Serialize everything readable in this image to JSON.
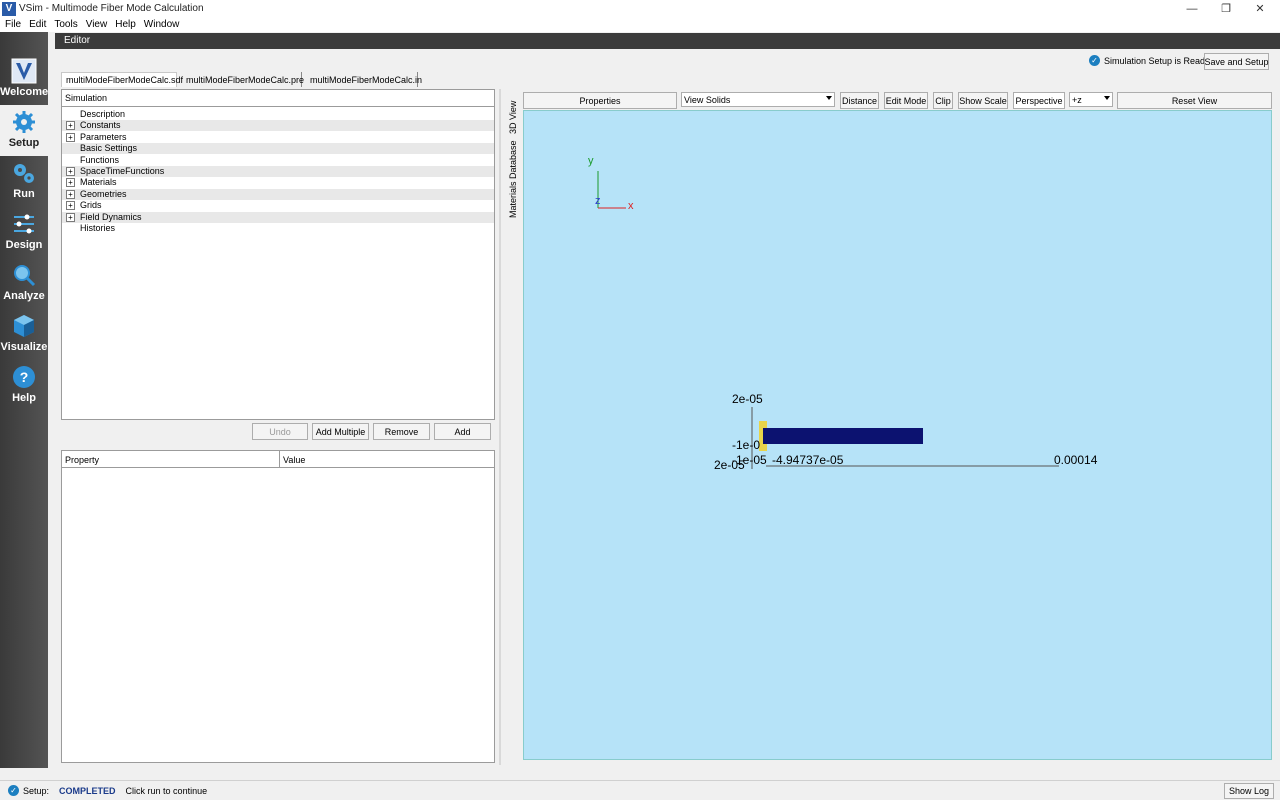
{
  "window": {
    "title": "VSim - Multimode Fiber Mode Calculation",
    "app_icon": "V",
    "controls": {
      "minimize": "—",
      "maximize": "❐",
      "close": "✕"
    }
  },
  "menu": [
    "File",
    "Edit",
    "Tools",
    "View",
    "Help",
    "Window"
  ],
  "nav": [
    {
      "label": "Welcome",
      "icon": "vsim-logo-icon"
    },
    {
      "label": "Setup",
      "icon": "gear-icon"
    },
    {
      "label": "Run",
      "icon": "gears-icon"
    },
    {
      "label": "Design",
      "icon": "sliders-icon"
    },
    {
      "label": "Analyze",
      "icon": "magnifier-icon"
    },
    {
      "label": "Visualize",
      "icon": "cube-icon"
    },
    {
      "label": "Help",
      "icon": "question-icon"
    }
  ],
  "editor": {
    "title": "Editor",
    "status": "Simulation Setup is Ready",
    "save_setup": "Save and Setup",
    "file_tabs": [
      "multiModeFiberModeCalc.sdf",
      "multiModeFiberModeCalc.pre",
      "multiModeFiberModeCalc.in"
    ]
  },
  "tree": {
    "header": "Simulation",
    "items": [
      {
        "label": "Description",
        "expandable": false
      },
      {
        "label": "Constants",
        "expandable": true
      },
      {
        "label": "Parameters",
        "expandable": true
      },
      {
        "label": "Basic Settings",
        "expandable": false
      },
      {
        "label": "Functions",
        "expandable": false
      },
      {
        "label": "SpaceTimeFunctions",
        "expandable": true
      },
      {
        "label": "Materials",
        "expandable": true
      },
      {
        "label": "Geometries",
        "expandable": true
      },
      {
        "label": "Grids",
        "expandable": true
      },
      {
        "label": "Field Dynamics",
        "expandable": true
      },
      {
        "label": "Histories",
        "expandable": false
      }
    ],
    "expander_symbol": "+"
  },
  "tree_buttons": {
    "undo": "Undo",
    "add_multiple": "Add Multiple",
    "remove": "Remove",
    "add": "Add"
  },
  "properties": {
    "col_property": "Property",
    "col_value": "Value"
  },
  "side_tabs": [
    "3D View",
    "Materials Database"
  ],
  "view3d": {
    "properties": "Properties",
    "view_select": "View Solids",
    "distance": "Distance",
    "edit_mode": "Edit Mode",
    "clip": "Clip",
    "show_scale": "Show Scale",
    "perspective": "Perspective",
    "axis_select": "+z",
    "reset_view": "Reset View",
    "axis_labels": {
      "x": "x",
      "y": "y",
      "z": "z"
    },
    "scale_labels": {
      "y_top": "2e-05",
      "y_mid": "-1e-0",
      "y_bottom_a": "2e-05",
      "y_bottom_b": "-1e-05",
      "x_left": "-4.94737e-05",
      "x_right": "0.00014"
    },
    "colors": {
      "background": "#b6e3f8",
      "fiber": "#0c1270",
      "cladding": "#e8d44a"
    }
  },
  "statusbar": {
    "label": "Setup:",
    "state": "COMPLETED",
    "message": "Click run to continue",
    "show_log": "Show Log"
  }
}
